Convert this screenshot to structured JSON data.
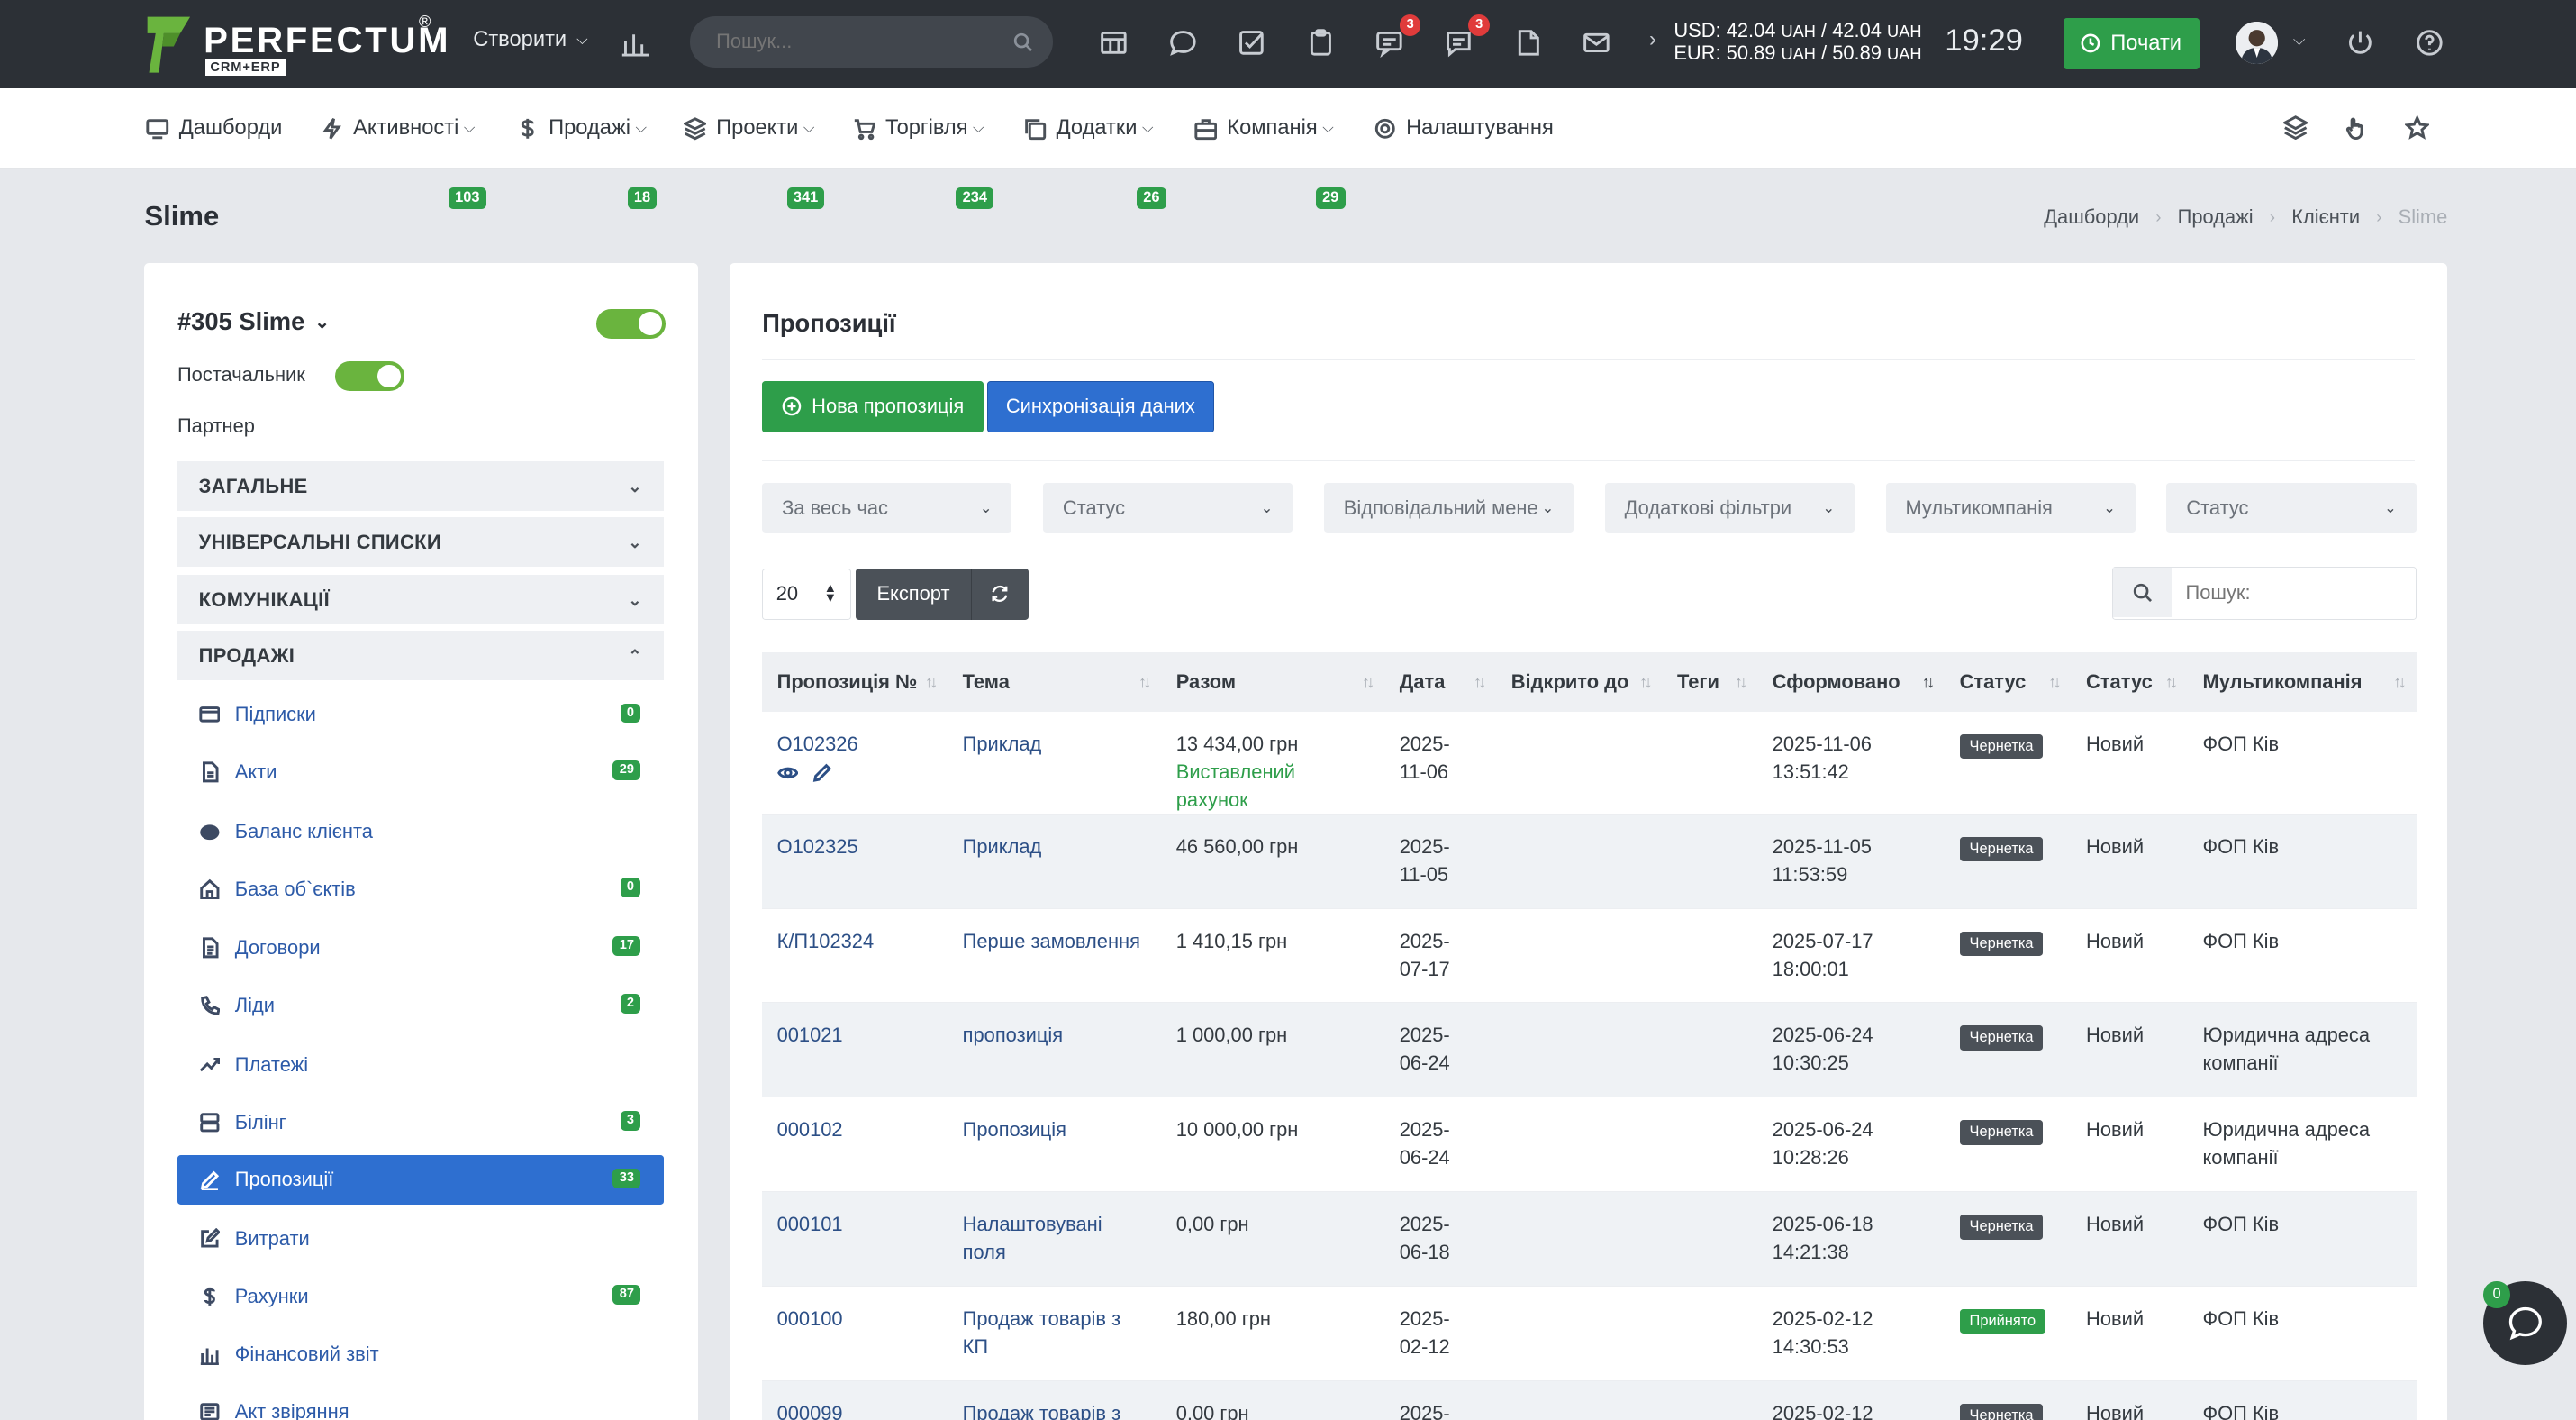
{
  "app": {
    "brand": "PERFECTUM",
    "brand_sub": "CRM+ERP",
    "brand_reg": "®"
  },
  "topbar": {
    "create_label": "Створити",
    "search_placeholder": "Пошук...",
    "notif_badge_1": "3",
    "notif_badge_2": "3",
    "usd_label": "USD: 42.04",
    "usd_unit1": "UAH",
    "usd_mid": "/ 42.04",
    "usd_unit2": "UAH",
    "eur_label": "EUR: 50.89",
    "eur_unit1": "UAH",
    "eur_mid": "/ 50.89",
    "eur_unit2": "UAH",
    "clock": "19:29",
    "start_label": "Почати"
  },
  "nav": {
    "items": [
      {
        "label": "Дашборди",
        "badge": ""
      },
      {
        "label": "Активності",
        "badge": "103"
      },
      {
        "label": "Продажі",
        "badge": "18"
      },
      {
        "label": "Проекти",
        "badge": "341"
      },
      {
        "label": "Торгівля",
        "badge": "234"
      },
      {
        "label": "Додатки",
        "badge": "26"
      },
      {
        "label": "Компанія",
        "badge": "29"
      },
      {
        "label": "Налаштування",
        "badge": ""
      }
    ]
  },
  "page": {
    "title": "Slime",
    "breadcrumb": [
      "Дашборди",
      "Продажі",
      "Клієнти",
      "Slime"
    ]
  },
  "sidebar": {
    "client_name": "#305 Slime",
    "supplier_label": "Постачальник",
    "partner_label": "Партнер",
    "sections": [
      "ЗАГАЛЬНЕ",
      "УНІВЕРСАЛЬНІ СПИСКИ",
      "КОМУНІКАЦІЇ",
      "ПРОДАЖІ"
    ],
    "items": [
      {
        "label": "Підписки",
        "count": "0"
      },
      {
        "label": "Акти",
        "count": "29"
      },
      {
        "label": "Баланс клієнта",
        "count": ""
      },
      {
        "label": "База об`єктів",
        "count": "0"
      },
      {
        "label": "Договори",
        "count": "17"
      },
      {
        "label": "Ліди",
        "count": "2"
      },
      {
        "label": "Платежі",
        "count": ""
      },
      {
        "label": "Білінг",
        "count": "3"
      },
      {
        "label": "Пропозиції",
        "count": "33"
      },
      {
        "label": "Витрати",
        "count": ""
      },
      {
        "label": "Рахунки",
        "count": "87"
      },
      {
        "label": "Фінансовий звіт",
        "count": ""
      },
      {
        "label": "Акт звіряння",
        "count": ""
      }
    ]
  },
  "main": {
    "title": "Пропозиції",
    "new_button": "Нова пропозиція",
    "sync_button": "Синхронізація даних",
    "filters": [
      "За весь час",
      "Статус",
      "Відповідальний мене",
      "Додаткові фільтри",
      "Мультикомпанія",
      "Статус"
    ],
    "per_page": "20",
    "export_label": "Експорт",
    "search_placeholder": "Пошук:"
  },
  "table": {
    "columns": [
      "Пропозиція №",
      "Тема",
      "Разом",
      "Дата",
      "Відкрито до",
      "Теги",
      "Сформовано",
      "Статус",
      "Статус",
      "Мультикомпанія"
    ],
    "rows": [
      {
        "num": "O102326",
        "topic": "Приклад",
        "total": "13 434,00 грн",
        "total_sub": "Виставлений рахунок",
        "date1": "2025-",
        "date2": "11-06",
        "open": "",
        "tags": "",
        "formed1": "2025-11-06",
        "formed2": "13:51:42",
        "status": "Чернетка",
        "status_ok": false,
        "status2": "Новий",
        "company1": "ФОП Ків",
        "company2": ""
      },
      {
        "num": "O102325",
        "topic": "Приклад",
        "total": "46 560,00 грн",
        "total_sub": "",
        "date1": "2025-",
        "date2": "11-05",
        "open": "",
        "tags": "",
        "formed1": "2025-11-05",
        "formed2": "11:53:59",
        "status": "Чернетка",
        "status_ok": false,
        "status2": "Новий",
        "company1": "ФОП Ків",
        "company2": ""
      },
      {
        "num": "К/П102324",
        "topic": "Перше замовлення",
        "total": "1 410,15 грн",
        "total_sub": "",
        "date1": "2025-",
        "date2": "07-17",
        "open": "",
        "tags": "",
        "formed1": "2025-07-17",
        "formed2": "18:00:01",
        "status": "Чернетка",
        "status_ok": false,
        "status2": "Новий",
        "company1": "ФОП Ків",
        "company2": ""
      },
      {
        "num": "001021",
        "topic": "пропозиція",
        "total": "1 000,00 грн",
        "total_sub": "",
        "date1": "2025-",
        "date2": "06-24",
        "open": "",
        "tags": "",
        "formed1": "2025-06-24",
        "formed2": "10:30:25",
        "status": "Чернетка",
        "status_ok": false,
        "status2": "Новий",
        "company1": "Юридична адреса",
        "company2": "компанії"
      },
      {
        "num": "000102",
        "topic": "Пропозиція",
        "total": "10 000,00 грн",
        "total_sub": "",
        "date1": "2025-",
        "date2": "06-24",
        "open": "",
        "tags": "",
        "formed1": "2025-06-24",
        "formed2": "10:28:26",
        "status": "Чернетка",
        "status_ok": false,
        "status2": "Новий",
        "company1": "Юридична адреса",
        "company2": "компанії"
      },
      {
        "num": "000101",
        "topic": "Налаштовувані поля",
        "total": "0,00 грн",
        "total_sub": "",
        "date1": "2025-",
        "date2": "06-18",
        "open": "",
        "tags": "",
        "formed1": "2025-06-18",
        "formed2": "14:21:38",
        "status": "Чернетка",
        "status_ok": false,
        "status2": "Новий",
        "company1": "ФОП Ків",
        "company2": ""
      },
      {
        "num": "000100",
        "topic": "Продаж товарів з КП",
        "total": "180,00 грн",
        "total_sub": "",
        "date1": "2025-",
        "date2": "02-12",
        "open": "",
        "tags": "",
        "formed1": "2025-02-12",
        "formed2": "14:30:53",
        "status": "Прийнято",
        "status_ok": true,
        "status2": "Новий",
        "company1": "ФОП Ків",
        "company2": ""
      },
      {
        "num": "000099",
        "topic": "Продаж товарів з",
        "total": "0,00 грн",
        "total_sub": "",
        "date1": "2025-",
        "date2": "",
        "open": "",
        "tags": "",
        "formed1": "2025-02-12",
        "formed2": "",
        "status": "Чернетка",
        "status_ok": false,
        "status2": "Новий",
        "company1": "ФОП Ків",
        "company2": ""
      }
    ]
  },
  "chat": {
    "badge": "0"
  },
  "colors": {
    "accent_green": "#2e9e4a",
    "accent_blue": "#2e6fd0",
    "topbar": "#2c3036",
    "badge_red": "#e03b3b"
  }
}
